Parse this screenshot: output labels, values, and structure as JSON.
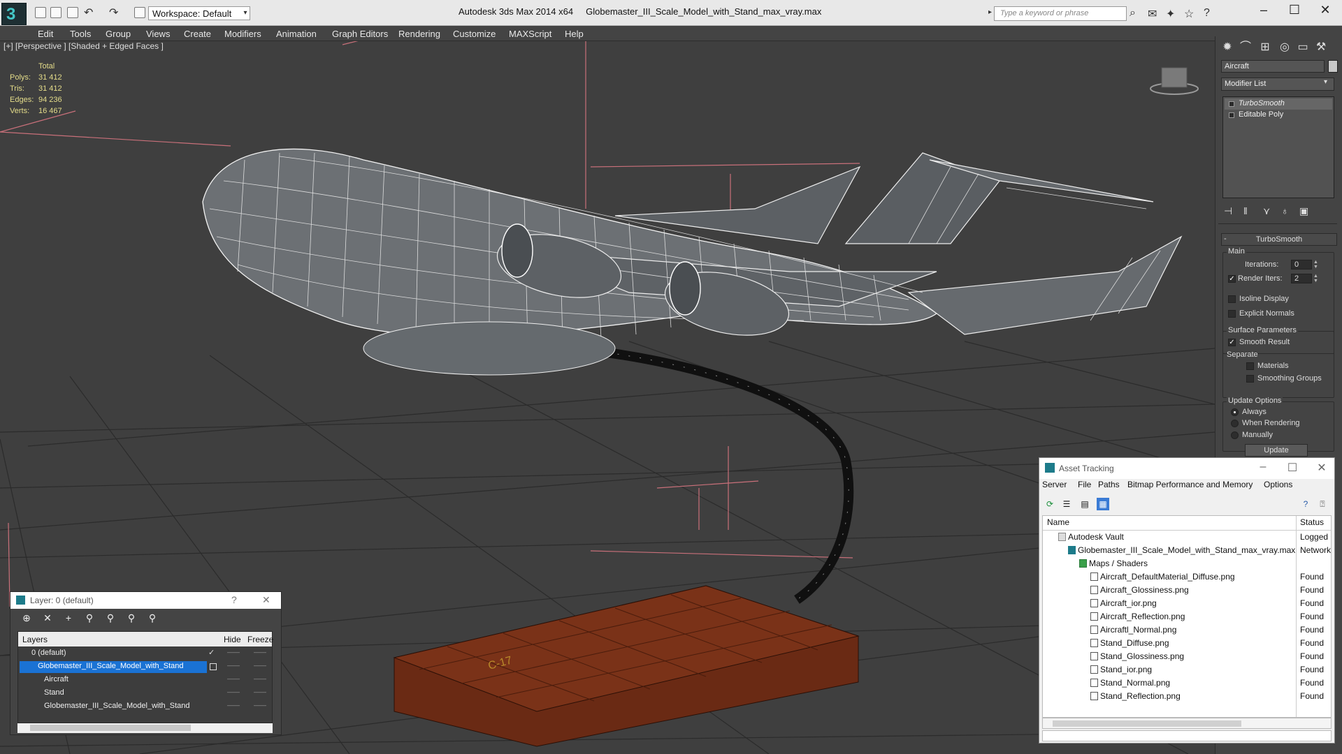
{
  "titlebar": {
    "workspace": "Workspace: Default",
    "app_name": "Autodesk 3ds Max  2014 x64",
    "file_name": "Globemaster_III_Scale_Model_with_Stand_max_vray.max",
    "search_placeholder": "Type a keyword or phrase"
  },
  "menu": [
    "Edit",
    "Tools",
    "Group",
    "Views",
    "Create",
    "Modifiers",
    "Animation",
    "Graph Editors",
    "Rendering",
    "Customize",
    "MAXScript",
    "Help"
  ],
  "viewport": {
    "label": "[+] [Perspective ] [Shaded + Edged Faces ]",
    "stats": {
      "header": "Total",
      "rows": [
        {
          "label": "Polys:",
          "value": "31 412"
        },
        {
          "label": "Tris:",
          "value": "31 412"
        },
        {
          "label": "Edges:",
          "value": "94 236"
        },
        {
          "label": "Verts:",
          "value": "16 467"
        }
      ]
    },
    "stand_text": "C-17"
  },
  "command_panel": {
    "object_name": "Aircraft",
    "modifier_list": "Modifier List",
    "stack": [
      "TurboSmooth",
      "Editable Poly"
    ],
    "rollout_title": "TurboSmooth",
    "main_group": "Main",
    "iterations_label": "Iterations:",
    "iterations_value": "0",
    "render_iters_label": "Render Iters:",
    "render_iters_value": "2",
    "render_iters_checked": true,
    "isoline_label": "Isoline Display",
    "explicit_label": "Explicit Normals",
    "surface_group": "Surface Parameters",
    "smooth_result_label": "Smooth Result",
    "separate_label": "Separate",
    "materials_label": "Materials",
    "smoothing_label": "Smoothing Groups",
    "update_group": "Update Options",
    "always_label": "Always",
    "when_rendering_label": "When Rendering",
    "manually_label": "Manually",
    "update_button": "Update"
  },
  "asset_tracking": {
    "title": "Asset Tracking",
    "menu": [
      "Server",
      "File",
      "Paths",
      "Bitmap Performance and Memory",
      "Options"
    ],
    "col_name": "Name",
    "col_status": "Status",
    "rows": [
      {
        "name": "Autodesk Vault",
        "status": "Logged O",
        "indent": 0
      },
      {
        "name": "Globemaster_III_Scale_Model_with_Stand_max_vray.max",
        "status": "Network",
        "indent": 1
      },
      {
        "name": "Maps / Shaders",
        "status": "",
        "indent": 2
      },
      {
        "name": "Aircraft_DefaultMaterial_Diffuse.png",
        "status": "Found",
        "indent": 3
      },
      {
        "name": "Aircraft_Glossiness.png",
        "status": "Found",
        "indent": 3
      },
      {
        "name": "Aircraft_ior.png",
        "status": "Found",
        "indent": 3
      },
      {
        "name": "Aircraft_Reflection.png",
        "status": "Found",
        "indent": 3
      },
      {
        "name": "Aircraftl_Normal.png",
        "status": "Found",
        "indent": 3
      },
      {
        "name": "Stand_Diffuse.png",
        "status": "Found",
        "indent": 3
      },
      {
        "name": "Stand_Glossiness.png",
        "status": "Found",
        "indent": 3
      },
      {
        "name": "Stand_ior.png",
        "status": "Found",
        "indent": 3
      },
      {
        "name": "Stand_Normal.png",
        "status": "Found",
        "indent": 3
      },
      {
        "name": "Stand_Reflection.png",
        "status": "Found",
        "indent": 3
      }
    ]
  },
  "layer_manager": {
    "title": "Layer: 0 (default)",
    "help": "?",
    "col_layers": "Layers",
    "col_hide": "Hide",
    "col_freeze": "Freeze",
    "rows": [
      {
        "name": "0 (default)",
        "selected": false,
        "check": "✓"
      },
      {
        "name": "Globemaster_III_Scale_Model_with_Stand",
        "selected": true,
        "check": ""
      },
      {
        "name": "Aircraft",
        "selected": false,
        "check": ""
      },
      {
        "name": "Stand",
        "selected": false,
        "check": ""
      },
      {
        "name": "Globemaster_III_Scale_Model_with_Stand",
        "selected": false,
        "check": ""
      }
    ]
  },
  "colors": {
    "viewport_bg": "#3f3f3f",
    "stats_yellow": "#e5dd8a",
    "selection_blue": "#1a72d4",
    "stand_brown": "#6a2a14",
    "accent_teal": "#43c6c6"
  }
}
